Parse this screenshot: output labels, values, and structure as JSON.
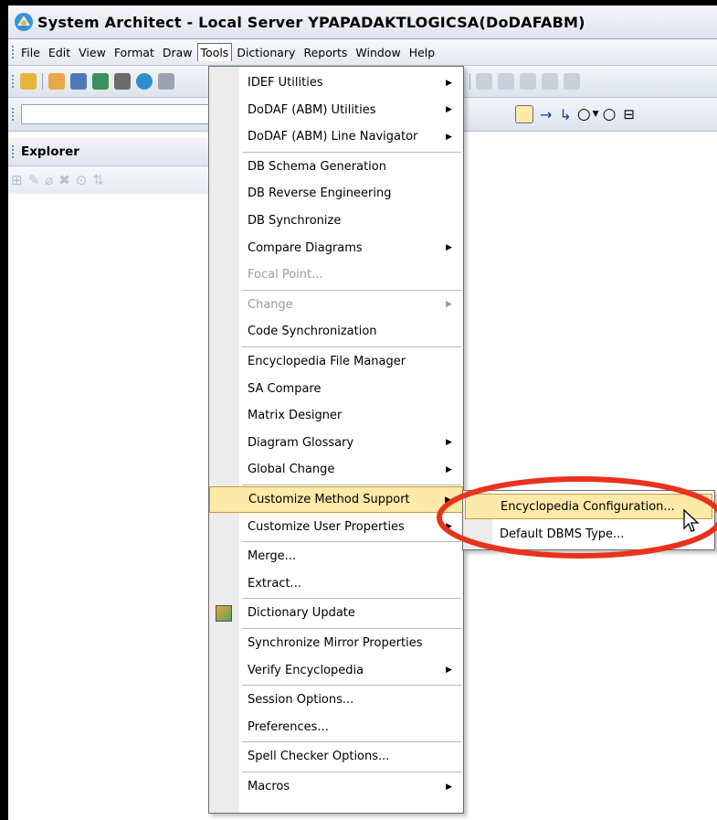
{
  "window": {
    "title": "System Architect - Local Server YPAPADAKTLOGICSA(DoDAFABM)"
  },
  "menubar": [
    {
      "label": "File"
    },
    {
      "label": "Edit"
    },
    {
      "label": "View"
    },
    {
      "label": "Format"
    },
    {
      "label": "Draw"
    },
    {
      "label": "Tools",
      "active": true
    },
    {
      "label": "Dictionary"
    },
    {
      "label": "Reports"
    },
    {
      "label": "Window"
    },
    {
      "label": "Help"
    }
  ],
  "explorer": {
    "title": "Explorer"
  },
  "tools_menu": {
    "items": [
      {
        "label": "IDEF Utilities",
        "submenu": true
      },
      {
        "label": "DoDAF (ABM) Utilities",
        "submenu": true
      },
      {
        "label": "DoDAF (ABM) Line Navigator",
        "submenu": true
      },
      {
        "label": "DB Schema Generation"
      },
      {
        "label": "DB Reverse Engineering"
      },
      {
        "label": "DB Synchronize"
      },
      {
        "label": "Compare Diagrams",
        "submenu": true
      },
      {
        "label": "Focal Point...",
        "disabled": true
      },
      {
        "label": "Change",
        "submenu": true,
        "disabled": true
      },
      {
        "label": "Code Synchronization"
      },
      {
        "label": "Encyclopedia File Manager"
      },
      {
        "label": "SA Compare"
      },
      {
        "label": "Matrix Designer"
      },
      {
        "label": "Diagram Glossary",
        "submenu": true
      },
      {
        "label": "Global Change",
        "submenu": true
      },
      {
        "label": "Customize Method Support",
        "submenu": true,
        "highlighted": true
      },
      {
        "label": "Customize User Properties",
        "submenu": true
      },
      {
        "label": "Merge..."
      },
      {
        "label": "Extract..."
      },
      {
        "label": "Dictionary Update",
        "icon": "dictionary-update-icon"
      },
      {
        "label": "Synchronize Mirror Properties"
      },
      {
        "label": "Verify Encyclopedia",
        "submenu": true
      },
      {
        "label": "Session Options..."
      },
      {
        "label": "Preferences..."
      },
      {
        "label": "Spell Checker Options..."
      },
      {
        "label": "Macros",
        "submenu": true
      }
    ]
  },
  "customize_submenu": {
    "items": [
      {
        "label": "Encyclopedia Configuration...",
        "highlighted": true
      },
      {
        "label": "Default DBMS Type..."
      }
    ]
  },
  "colors": {
    "highlight": "#fde9a8",
    "annotation_ellipse": "#e8321e"
  }
}
